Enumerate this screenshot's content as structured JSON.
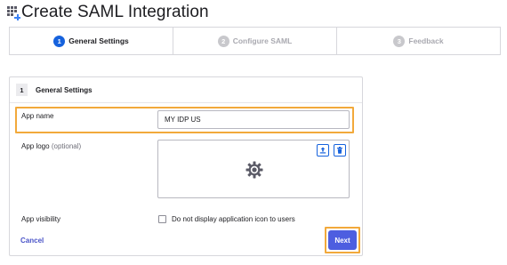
{
  "page": {
    "title": "Create SAML Integration",
    "title_icon": "grid-plus-icon"
  },
  "stepper": {
    "steps": [
      {
        "number": "1",
        "label": "General Settings",
        "state": "active"
      },
      {
        "number": "2",
        "label": "Configure SAML",
        "state": "inactive"
      },
      {
        "number": "3",
        "label": "Feedback",
        "state": "inactive"
      }
    ]
  },
  "section": {
    "number": "1",
    "title": "General Settings"
  },
  "form": {
    "app_name": {
      "label": "App name",
      "value": "MY IDP US"
    },
    "app_logo": {
      "label": "App logo",
      "optional_label": "(optional)",
      "upload_icon": "upload-icon",
      "delete_icon": "trash-icon",
      "placeholder_icon": "gear-icon"
    },
    "app_visibility": {
      "label": "App visibility",
      "checkbox_label": "Do not display application icon to users",
      "checked": false
    }
  },
  "actions": {
    "cancel_label": "Cancel",
    "next_label": "Next"
  },
  "colors": {
    "primary": "#1662dd",
    "next_button": "#4d5ee0",
    "highlight": "#f2a93b",
    "link": "#4a54c8"
  }
}
